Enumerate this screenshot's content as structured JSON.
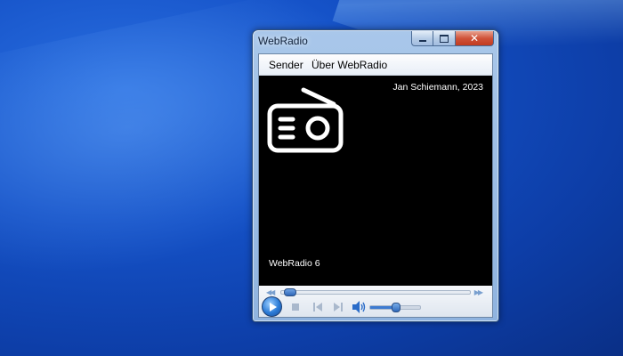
{
  "window": {
    "title": "WebRadio"
  },
  "caption_buttons": {
    "close_glyph": "✕"
  },
  "menu": {
    "items": [
      "Sender",
      "Über WebRadio"
    ]
  },
  "display": {
    "author": "Jan Schiemann, 2023",
    "station": "WebRadio 6",
    "logo_icon": "radio-icon"
  },
  "player": {
    "seek_progress": 0.02,
    "volume": 0.5,
    "icons": [
      "play-icon",
      "stop-icon",
      "previous-icon",
      "next-icon",
      "volume-icon"
    ]
  },
  "colors": {
    "desktop": "#1552c8",
    "display_bg": "#000000",
    "accent": "#2a7ad6",
    "close_red": "#c13a20"
  }
}
